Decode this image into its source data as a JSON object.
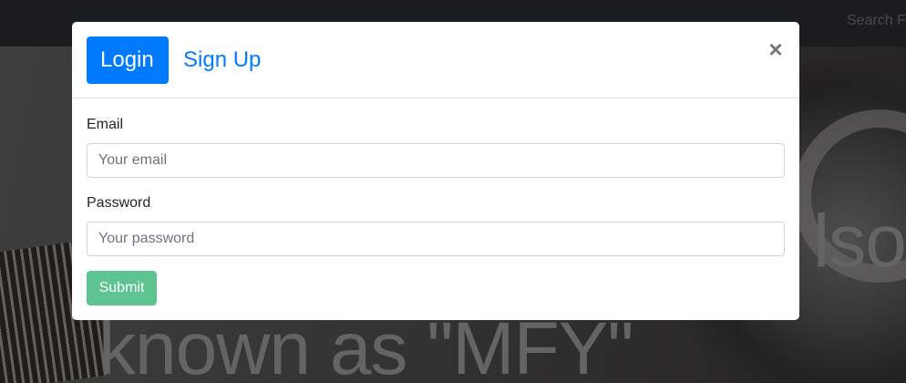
{
  "navbar": {
    "search_text": "Search F"
  },
  "hero": {
    "line1": "lso",
    "line2": "known as \"MFY\""
  },
  "modal": {
    "tabs": {
      "login": "Login",
      "signup": "Sign Up"
    },
    "close_symbol": "×",
    "email": {
      "label": "Email",
      "placeholder": "Your email",
      "value": ""
    },
    "password": {
      "label": "Password",
      "placeholder": "Your password",
      "value": ""
    },
    "submit_label": "Submit"
  },
  "colors": {
    "primary": "#007bff",
    "submit": "#5cc391",
    "navbar": "#343a40"
  }
}
